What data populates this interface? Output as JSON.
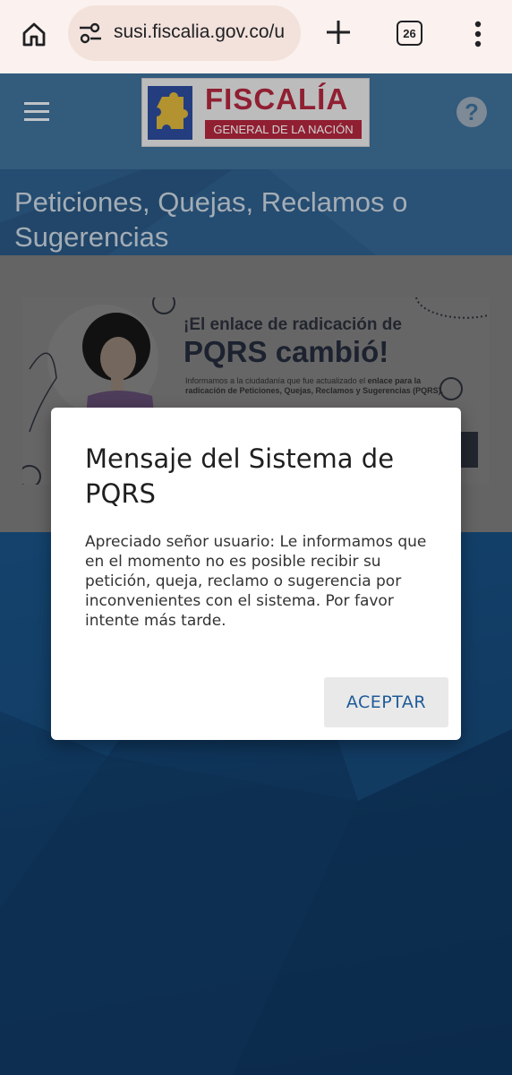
{
  "browser": {
    "url": "susi.fiscalia.gov.co/u",
    "tab_count": "26"
  },
  "site": {
    "logo_title": "FISCALÍA",
    "logo_subtitle": "GENERAL DE LA NACIÓN",
    "help_label": "?",
    "page_title": "Peticiones, Quejas, Reclamos o Sugerencias"
  },
  "banner": {
    "headline_1": "¡El enlace de radicación de",
    "headline_2": "PQRS cambió!",
    "body_prefix": "Informamos a la ciudadanía que fue actualizado el ",
    "body_bold": "enlace para la radicación de Peticiones, Quejas, Reclamos y Sugerencias (PQRS)."
  },
  "dialog": {
    "title": "Mensaje del Sistema de PQRS",
    "message": "Apreciado señor usuario: Le informamos que en el momento no es posible recibir su petición, queja, reclamo o sugerencia por inconvenientes con el sistema. Por favor intente más tarde.",
    "accept_label": "ACEPTAR"
  },
  "colors": {
    "brand_red": "#b0273d",
    "header_blue": "#3e6f98",
    "accept_text": "#1f5b98"
  }
}
